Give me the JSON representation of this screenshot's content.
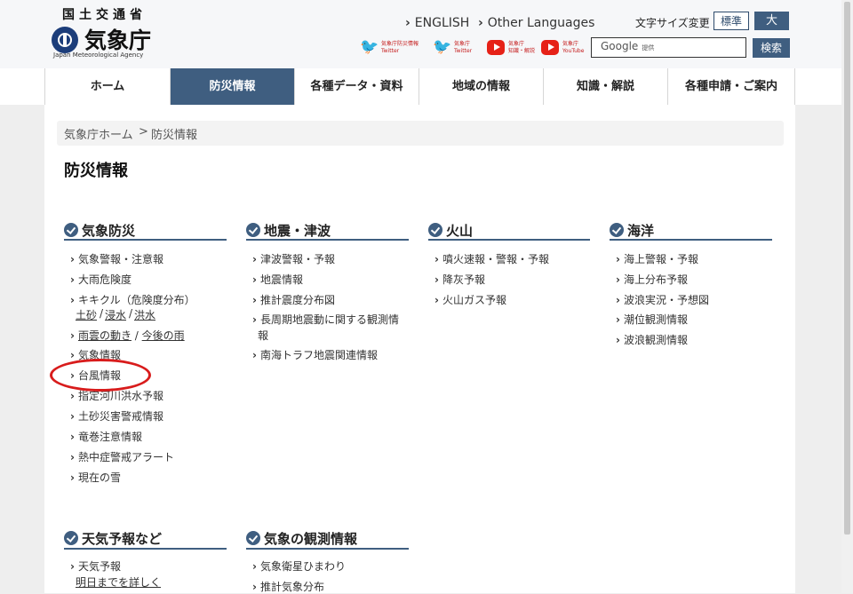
{
  "header": {
    "org_top": "国土交通省",
    "org_name": "気象庁",
    "org_sub": "Japan Meteorological Agency",
    "english_link": "ENGLISH",
    "other_languages_link": "Other Languages",
    "font_size_label": "文字サイズ変更",
    "font_standard": "標準",
    "font_large": "大",
    "search_brand": "Google",
    "search_brand_suffix": "提供",
    "search_button": "検索",
    "social": [
      {
        "line1": "気象庁防災情報",
        "line2": "Twitter",
        "icon": "twitter-icon"
      },
      {
        "line1": "気象庁",
        "line2": "Twitter",
        "icon": "twitter-icon"
      },
      {
        "line1": "気象庁",
        "line2": "知識・解説",
        "icon": "youtube-icon"
      },
      {
        "line1": "気象庁",
        "line2": "YouTube",
        "icon": "youtube-icon"
      }
    ]
  },
  "nav": [
    "ホーム",
    "防災情報",
    "各種データ・資料",
    "地域の情報",
    "知識・解説",
    "各種申請・ご案内"
  ],
  "nav_active_index": 1,
  "breadcrumb": {
    "home": "気象庁ホーム",
    "sep": ">",
    "current": "防災情報"
  },
  "page_title": "防災情報",
  "sections": {
    "weather": {
      "title": "気象防災",
      "links": [
        "気象警報・注意報",
        "大雨危険度",
        "キキクル（危険度分布）",
        "雨雲の動き",
        "今後の雨",
        "気象情報",
        "台風情報",
        "指定河川洪水予報",
        "土砂災害警戒情報",
        "竜巻注意情報",
        "熱中症警戒アラート",
        "現在の雪"
      ],
      "kikikuru_sub": [
        "土砂",
        "浸水",
        "洪水"
      ],
      "sub_sep": "/"
    },
    "quake": {
      "title": "地震・津波",
      "links": [
        "津波警報・予報",
        "地震情報",
        "推計震度分布図",
        "長周期地震動に関する観測情",
        "報",
        "南海トラフ地震関連情報"
      ]
    },
    "volcano": {
      "title": "火山",
      "links": [
        "噴火速報・警報・予報",
        "降灰予報",
        "火山ガス予報"
      ]
    },
    "ocean": {
      "title": "海洋",
      "links": [
        "海上警報・予報",
        "海上分布予報",
        "波浪実況・予想図",
        "潮位観測情報",
        "波浪観測情報"
      ]
    },
    "forecast": {
      "title": "天気予報など",
      "links": [
        "天気予報"
      ],
      "sub_link": "明日までを詳しく"
    },
    "observation": {
      "title": "気象の観測情報",
      "links": [
        "気象衛星ひまわり",
        "推計気象分布"
      ]
    }
  },
  "colors": {
    "accent": "#3f5e80",
    "highlight": "#d81c1c"
  }
}
